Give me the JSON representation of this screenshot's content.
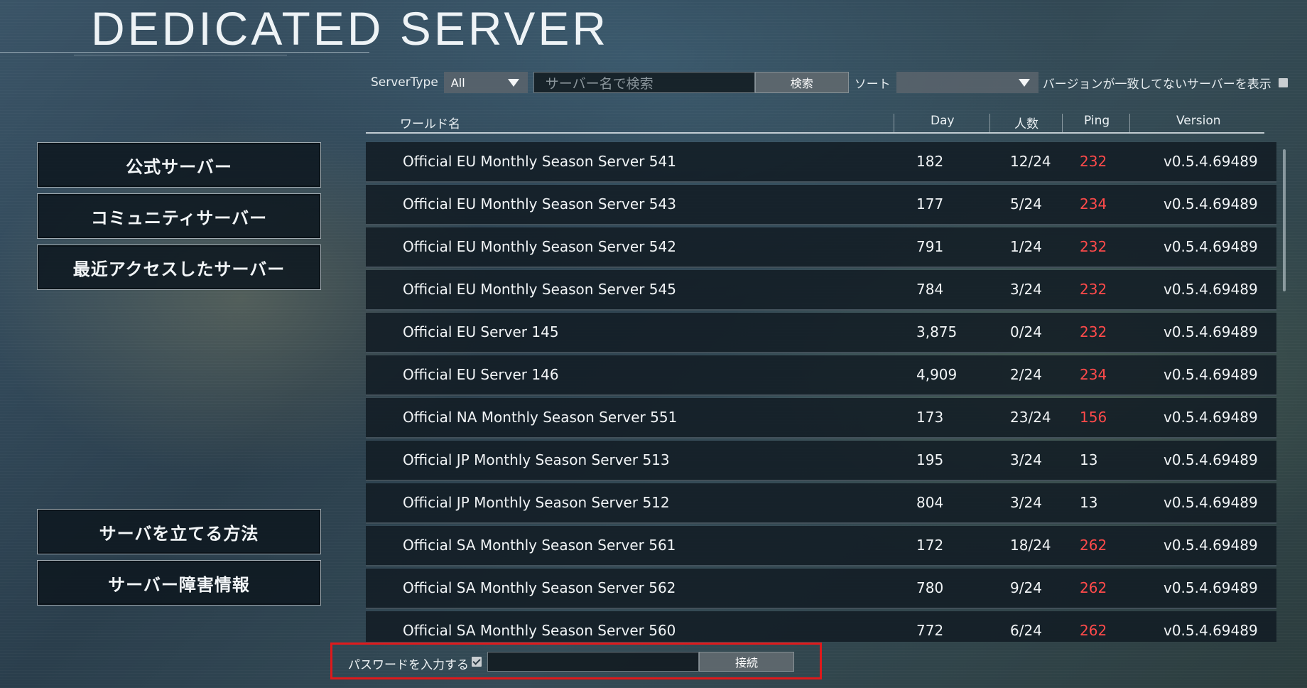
{
  "page": {
    "title": "DEDICATED SERVER"
  },
  "nav": {
    "official": "公式サーバー",
    "community": "コミュニティサーバー",
    "recent": "最近アクセスしたサーバー",
    "howto": "サーバを立てる方法",
    "outage": "サーバー障害情報"
  },
  "filters": {
    "server_type_label": "ServerType",
    "server_type_value": "All",
    "search_placeholder": "サーバー名で検索",
    "search_button": "検索",
    "sort_label": "ソート",
    "sort_value": "",
    "mismatch_label": "バージョンが一致してないサーバーを表示",
    "mismatch_checked": false
  },
  "table": {
    "headers": {
      "name": "ワールド名",
      "day": "Day",
      "players": "人数",
      "ping": "Ping",
      "version": "Version"
    },
    "rows": [
      {
        "name": "Official EU Monthly Season Server 541",
        "day": "182",
        "players": "12/24",
        "ping": "232",
        "high": true,
        "version": "v0.5.4.69489"
      },
      {
        "name": "Official EU Monthly Season Server 543",
        "day": "177",
        "players": "5/24",
        "ping": "234",
        "high": true,
        "version": "v0.5.4.69489"
      },
      {
        "name": "Official EU Monthly Season Server 542",
        "day": "791",
        "players": "1/24",
        "ping": "232",
        "high": true,
        "version": "v0.5.4.69489"
      },
      {
        "name": "Official EU Monthly Season Server 545",
        "day": "784",
        "players": "3/24",
        "ping": "232",
        "high": true,
        "version": "v0.5.4.69489"
      },
      {
        "name": "Official EU Server 145",
        "day": "3,875",
        "players": "0/24",
        "ping": "232",
        "high": true,
        "version": "v0.5.4.69489"
      },
      {
        "name": "Official EU Server 146",
        "day": "4,909",
        "players": "2/24",
        "ping": "234",
        "high": true,
        "version": "v0.5.4.69489"
      },
      {
        "name": "Official NA Monthly Season Server 551",
        "day": "173",
        "players": "23/24",
        "ping": "156",
        "high": true,
        "version": "v0.5.4.69489"
      },
      {
        "name": "Official JP Monthly Season Server 513",
        "day": "195",
        "players": "3/24",
        "ping": "13",
        "high": false,
        "version": "v0.5.4.69489"
      },
      {
        "name": "Official JP Monthly Season Server 512",
        "day": "804",
        "players": "3/24",
        "ping": "13",
        "high": false,
        "version": "v0.5.4.69489"
      },
      {
        "name": "Official SA Monthly Season Server 561",
        "day": "172",
        "players": "18/24",
        "ping": "262",
        "high": true,
        "version": "v0.5.4.69489"
      },
      {
        "name": "Official SA Monthly Season Server 562",
        "day": "780",
        "players": "9/24",
        "ping": "262",
        "high": true,
        "version": "v0.5.4.69489"
      },
      {
        "name": "Official SA Monthly Season Server 560",
        "day": "772",
        "players": "6/24",
        "ping": "262",
        "high": true,
        "version": "v0.5.4.69489"
      }
    ]
  },
  "password": {
    "label": "パスワードを入力する",
    "checked": true,
    "value": "",
    "connect_button": "接続"
  },
  "colors": {
    "high_ping": "#ff4a4a",
    "highlight_border": "#e0191b"
  }
}
